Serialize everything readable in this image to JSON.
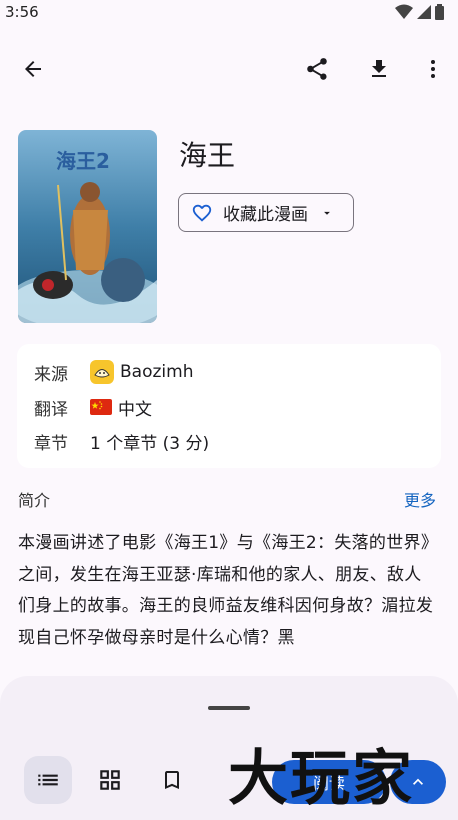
{
  "status": {
    "time": "3:56"
  },
  "manga": {
    "title": "海王",
    "favorite_label": "收藏此漫画"
  },
  "info": {
    "source_key": "来源",
    "source_value": "Baozimh",
    "translation_key": "翻译",
    "translation_value": "中文",
    "chapters_key": "章节",
    "chapters_value": "1 个章节 (3 分)"
  },
  "intro": {
    "title": "简介",
    "more": "更多",
    "text": "本漫画讲述了电影《海王1》与《海王2：失落的世界》之间，发生在海王亚瑟·库瑞和他的家人、朋友、敌人们身上的故事。海王的良师益友维科因何身故？湄拉发现自己怀孕做母亲时是什么心情？黑"
  },
  "bottom": {
    "read_label": "阅读"
  },
  "watermark": "大玩家",
  "colors": {
    "accent": "#1b5fd1",
    "link": "#1565c0",
    "background": "#fcf8fd",
    "sheet": "#f4eff7"
  }
}
